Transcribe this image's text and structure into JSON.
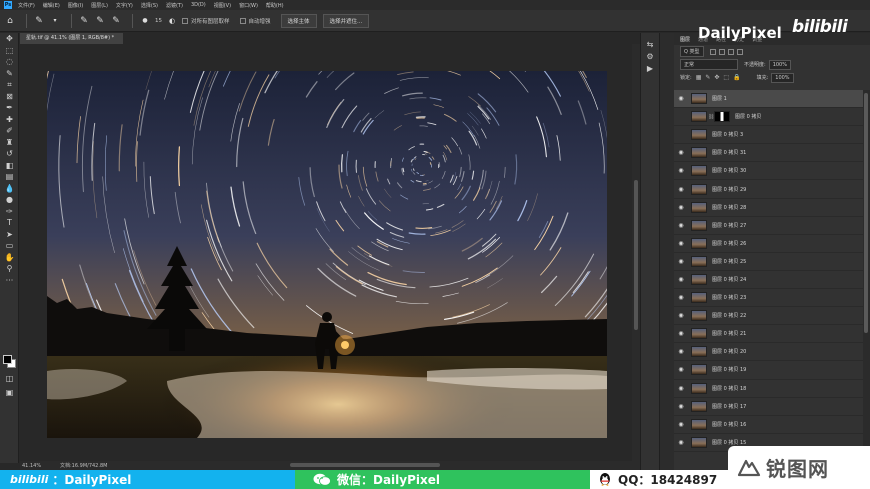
{
  "app": {
    "logo": "Ps",
    "menu": [
      "文件(F)",
      "编辑(E)",
      "图像(I)",
      "图层(L)",
      "文字(Y)",
      "选择(S)",
      "滤镜(T)",
      "3D(D)",
      "视图(V)",
      "窗口(W)",
      "帮助(H)"
    ]
  },
  "options_bar": {
    "checkbox_all_layers": "对所有图层取样",
    "checkbox_auto_enhance": "自动增强",
    "btn_select_subject": "选择主体",
    "btn_select_and_mask": "选择并遮住...",
    "brush_size": "15"
  },
  "document": {
    "tab_title": "星轨.tif @ 41.1% (图层 1, RGB/8#) *",
    "zoom": "41.14%",
    "doc_info": "文档:16.9M/742.8M"
  },
  "layers_panel": {
    "tabs": [
      "图层",
      "通道",
      "路径",
      "历史",
      "调整"
    ],
    "filter_kind": "Q 类型",
    "blend_mode": "正常",
    "opacity_label": "不透明度:",
    "opacity_value": "100%",
    "lock_label": "锁定:",
    "fill_label": "填充:",
    "fill_value": "100%",
    "layers": [
      {
        "name": "图层 1",
        "visible": true,
        "selected": true,
        "has_mask": false
      },
      {
        "name": "图层 0 拷贝",
        "visible": false,
        "selected": false,
        "has_mask": true
      },
      {
        "name": "图层 0 拷贝 3",
        "visible": false,
        "selected": false,
        "has_mask": false
      },
      {
        "name": "图层 0 拷贝 31",
        "visible": true,
        "selected": false,
        "has_mask": false
      },
      {
        "name": "图层 0 拷贝 30",
        "visible": true,
        "selected": false,
        "has_mask": false
      },
      {
        "name": "图层 0 拷贝 29",
        "visible": true,
        "selected": false,
        "has_mask": false
      },
      {
        "name": "图层 0 拷贝 28",
        "visible": true,
        "selected": false,
        "has_mask": false
      },
      {
        "name": "图层 0 拷贝 27",
        "visible": true,
        "selected": false,
        "has_mask": false
      },
      {
        "name": "图层 0 拷贝 26",
        "visible": true,
        "selected": false,
        "has_mask": false
      },
      {
        "name": "图层 0 拷贝 25",
        "visible": true,
        "selected": false,
        "has_mask": false
      },
      {
        "name": "图层 0 拷贝 24",
        "visible": true,
        "selected": false,
        "has_mask": false
      },
      {
        "name": "图层 0 拷贝 23",
        "visible": true,
        "selected": false,
        "has_mask": false
      },
      {
        "name": "图层 0 拷贝 22",
        "visible": true,
        "selected": false,
        "has_mask": false
      },
      {
        "name": "图层 0 拷贝 21",
        "visible": true,
        "selected": false,
        "has_mask": false
      },
      {
        "name": "图层 0 拷贝 20",
        "visible": true,
        "selected": false,
        "has_mask": false
      },
      {
        "name": "图层 0 拷贝 19",
        "visible": true,
        "selected": false,
        "has_mask": false
      },
      {
        "name": "图层 0 拷贝 18",
        "visible": true,
        "selected": false,
        "has_mask": false
      },
      {
        "name": "图层 0 拷贝 17",
        "visible": true,
        "selected": false,
        "has_mask": false
      },
      {
        "name": "图层 0 拷贝 16",
        "visible": true,
        "selected": false,
        "has_mask": false
      },
      {
        "name": "图层 0 拷贝 15",
        "visible": true,
        "selected": false,
        "has_mask": false
      }
    ]
  },
  "watermark": {
    "brand": "DailyPixel",
    "bili_logo": "bilibili",
    "site_mark": "锐图网"
  },
  "banner": {
    "bili_label": "bilibili",
    "bili_text": "：DailyPixel",
    "wechat_text": "微信：DailyPixel",
    "qq_text": "QQ：18424897"
  },
  "colors": {
    "accent_ps": "#31a8ff",
    "banner_cyan": "#13b2ee",
    "banner_green": "#2fc25d"
  }
}
